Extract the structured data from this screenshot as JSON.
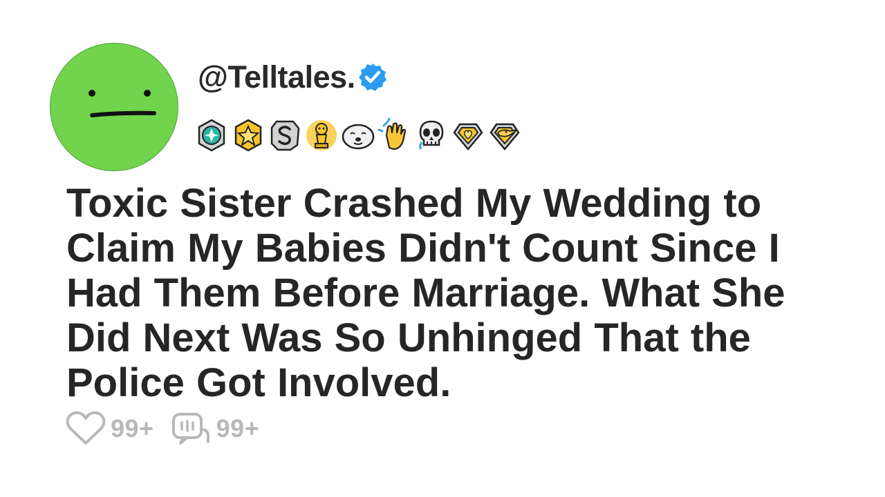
{
  "post": {
    "username": "@Telltales.",
    "title": "Toxic Sister Crashed My Wedding to Claim My Babies Didn't Count Since I Had Them Before Marriage. What She Did Next Was So Unhinged That the Police Got Involved.",
    "likes_count": "99+",
    "comments_count": "99+"
  },
  "avatar": {
    "color": "#71d44c",
    "icon": "neutral-face"
  },
  "verified_badge": {
    "icon": "verified-check-icon",
    "color": "#2b9cf0"
  },
  "award_badges": [
    "teal-gem-award-icon",
    "gold-star-award-icon",
    "silver-s-award-icon",
    "gold-trophy-award-icon",
    "seal-face-award-icon",
    "clapping-hands-award-icon",
    "skull-award-icon",
    "gold-heart-diamond-award-icon",
    "gold-bird-diamond-award-icon"
  ],
  "action_icons": {
    "like": "heart-outline-icon",
    "comment": "comment-bubble-icon"
  }
}
